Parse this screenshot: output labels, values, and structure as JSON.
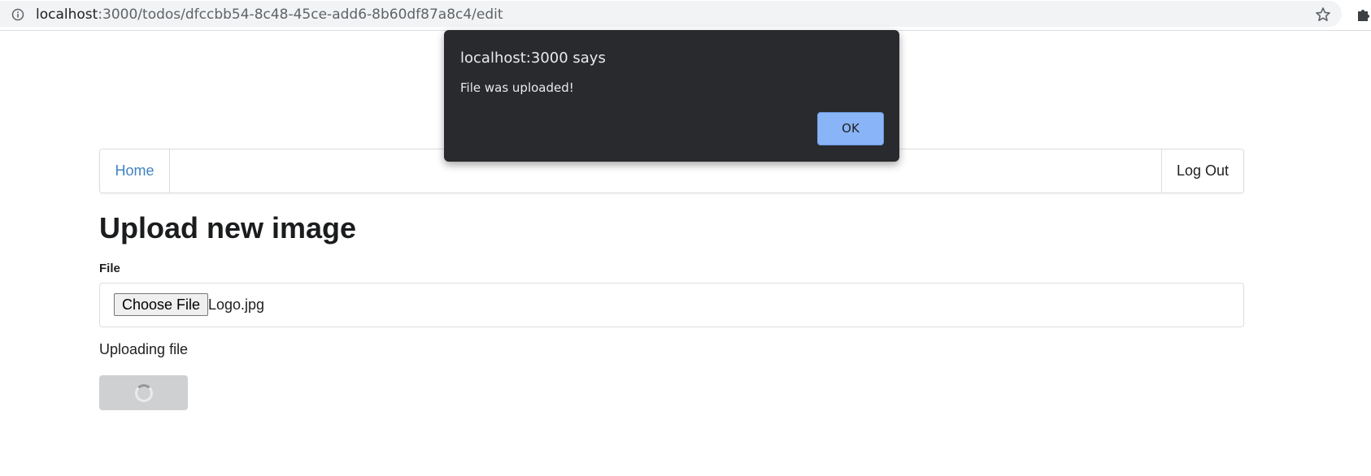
{
  "browser": {
    "url_host": "localhost",
    "url_path": ":3000/todos/dfccbb54-8c48-45ce-add6-8b60df87a8c4/edit",
    "icons": [
      "info-icon",
      "star-icon",
      "puzzle-icon"
    ]
  },
  "navbar": {
    "home_label": "Home",
    "logout_label": "Log Out",
    "link_color": "#4183c4"
  },
  "main": {
    "title": "Upload new image",
    "file_label": "File",
    "choose_file_label": "Choose File",
    "file_name": "Logo.jpg",
    "status_text": "Uploading file"
  },
  "alert": {
    "title": "localhost:3000 says",
    "message": "File was uploaded!",
    "ok_label": "OK",
    "button_color": "#8ab4f8",
    "background_color": "#292a2d"
  }
}
